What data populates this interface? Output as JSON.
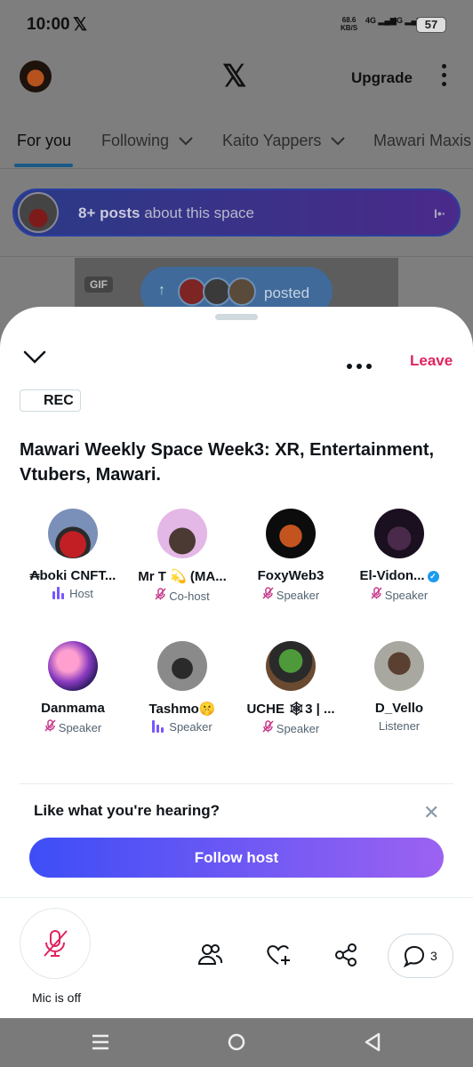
{
  "status_bar": {
    "time": "10:00",
    "x_badge": "𝕏",
    "network_speed": "68.6",
    "network_unit": "KB/S",
    "signal1": "4G",
    "signal2": "4G",
    "battery": "57"
  },
  "top_bar": {
    "logo": "𝕏",
    "upgrade_label": "Upgrade"
  },
  "feed_tabs": [
    {
      "label": "For you",
      "active": true
    },
    {
      "label": "Following",
      "dropdown": true
    },
    {
      "label": "Kaito Yappers",
      "dropdown": true
    },
    {
      "label": "Mawari Maxis"
    }
  ],
  "space_pill": {
    "count": "8+ posts",
    "text": "about this space"
  },
  "media_card": {
    "gif_label": "GIF",
    "posted_label": "posted"
  },
  "sheet": {
    "leave_label": "Leave",
    "rec_label": "REC",
    "title": "Mawari Weekly Space Week3: XR, Entertainment, Vtubers, Mawari."
  },
  "participants": [
    {
      "name": "₳boki CNFT...",
      "role": "Host",
      "state": "speaking"
    },
    {
      "name": "Mr T 💫 (MA...",
      "role": "Co-host",
      "state": "muted"
    },
    {
      "name": "FoxyWeb3",
      "role": "Speaker",
      "state": "muted"
    },
    {
      "name": "El-Vidon...",
      "role": "Speaker",
      "state": "muted",
      "verified": true
    },
    {
      "name": "Danmama",
      "role": "Speaker",
      "state": "muted"
    },
    {
      "name": "Tashmo🤫",
      "role": "Speaker",
      "state": "speaking"
    },
    {
      "name": "UCHE 🕸3 | ...",
      "role": "Speaker",
      "state": "muted"
    },
    {
      "name": "D_Vello",
      "role": "Listener",
      "state": "listener"
    }
  ],
  "prompt": {
    "text": "Like what you're hearing?",
    "follow_label": "Follow host"
  },
  "controls": {
    "mic_label": "Mic is off",
    "comment_count": "3"
  },
  "colors": {
    "accent_red": "#e0245e",
    "follow_start": "#3d4ef6",
    "follow_end": "#9c62f2",
    "speaker_purple": "#7856ff",
    "mic_off_red": "#e0245e"
  }
}
